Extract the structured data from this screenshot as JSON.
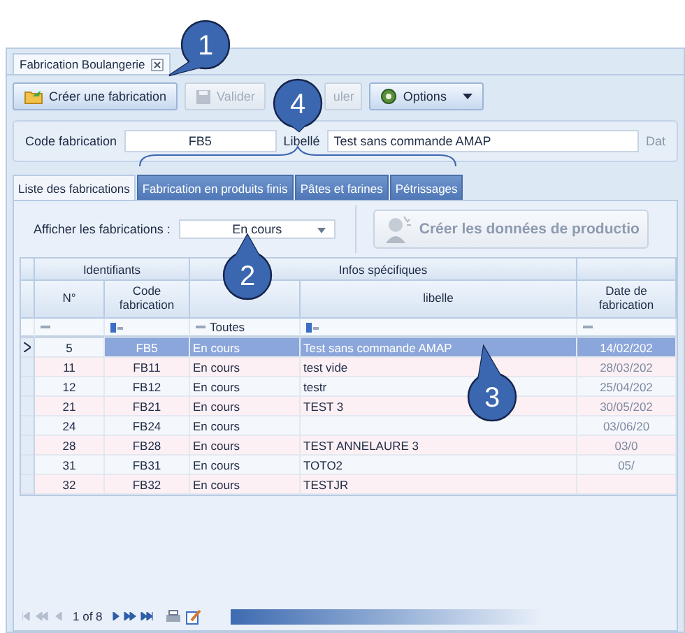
{
  "document_tab": {
    "label": "Fabrication Boulangerie"
  },
  "toolbar": [
    {
      "label": "Créer une fabrication",
      "kind": "create",
      "disabled": false
    },
    {
      "label": "Valider",
      "kind": "save",
      "disabled": true
    },
    {
      "label": "uler",
      "kind": "plain",
      "disabled": true
    },
    {
      "label": "Options",
      "kind": "options",
      "disabled": false
    }
  ],
  "header_fields": {
    "code_label": "Code fabrication",
    "code_value": "FB5",
    "libelle_label": "Libellé",
    "libelle_value": "Test sans commande AMAP",
    "date_label": "Dat"
  },
  "tabs": [
    {
      "label": "Liste des fabrications",
      "selected": true
    },
    {
      "label": "Fabrication en produits finis",
      "selected": false
    },
    {
      "label": "Pâtes et farines",
      "selected": false
    },
    {
      "label": "Pétrissages",
      "selected": false
    }
  ],
  "filter": {
    "label": "Afficher les fabrications :",
    "value": "En cours"
  },
  "production_button": {
    "label": "Créer les données de productio",
    "disabled": true
  },
  "grid": {
    "groups": [
      "Identifiants",
      "Infos spécifiques"
    ],
    "columns": [
      {
        "label": "N°"
      },
      {
        "label": "Code fabrication"
      },
      {
        "filter": "Toutes"
      },
      {
        "label": "libelle"
      },
      {
        "label": "Date de fabrication"
      }
    ],
    "rows": [
      {
        "n": "5",
        "code": "FB5",
        "status": "En cours",
        "libelle": "Test sans commande AMAP",
        "date": "14/02/202",
        "selected": true
      },
      {
        "n": "11",
        "code": "FB11",
        "status": "En cours",
        "libelle": "test vide",
        "date": "28/03/202",
        "selected": false
      },
      {
        "n": "12",
        "code": "FB12",
        "status": "En cours",
        "libelle": "testr",
        "date": "25/04/202",
        "selected": false
      },
      {
        "n": "21",
        "code": "FB21",
        "status": "En cours",
        "libelle": "TEST 3",
        "date": "30/05/202",
        "selected": false
      },
      {
        "n": "24",
        "code": "FB24",
        "status": "En cours",
        "libelle": "",
        "date": "03/06/20",
        "selected": false
      },
      {
        "n": "28",
        "code": "FB28",
        "status": "En cours",
        "libelle": "TEST ANNELAURE 3",
        "date": "03/0",
        "selected": false
      },
      {
        "n": "31",
        "code": "FB31",
        "status": "En cours",
        "libelle": "TOTO2",
        "date": "05/",
        "selected": false
      },
      {
        "n": "32",
        "code": "FB32",
        "status": "En cours",
        "libelle": "TESTJR",
        "date": "",
        "selected": false
      }
    ]
  },
  "pager": {
    "text": "1 of 8"
  },
  "callouts": [
    "1",
    "2",
    "3",
    "4"
  ]
}
